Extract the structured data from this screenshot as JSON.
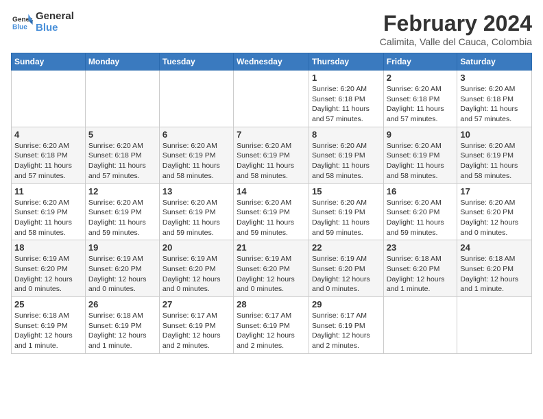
{
  "logo": {
    "line1": "General",
    "line2": "Blue"
  },
  "title": {
    "month_year": "February 2024",
    "location": "Calimita, Valle del Cauca, Colombia"
  },
  "days_of_week": [
    "Sunday",
    "Monday",
    "Tuesday",
    "Wednesday",
    "Thursday",
    "Friday",
    "Saturday"
  ],
  "weeks": [
    [
      {
        "day": "",
        "info": ""
      },
      {
        "day": "",
        "info": ""
      },
      {
        "day": "",
        "info": ""
      },
      {
        "day": "",
        "info": ""
      },
      {
        "day": "1",
        "info": "Sunrise: 6:20 AM\nSunset: 6:18 PM\nDaylight: 11 hours\nand 57 minutes."
      },
      {
        "day": "2",
        "info": "Sunrise: 6:20 AM\nSunset: 6:18 PM\nDaylight: 11 hours\nand 57 minutes."
      },
      {
        "day": "3",
        "info": "Sunrise: 6:20 AM\nSunset: 6:18 PM\nDaylight: 11 hours\nand 57 minutes."
      }
    ],
    [
      {
        "day": "4",
        "info": "Sunrise: 6:20 AM\nSunset: 6:18 PM\nDaylight: 11 hours\nand 57 minutes."
      },
      {
        "day": "5",
        "info": "Sunrise: 6:20 AM\nSunset: 6:18 PM\nDaylight: 11 hours\nand 57 minutes."
      },
      {
        "day": "6",
        "info": "Sunrise: 6:20 AM\nSunset: 6:19 PM\nDaylight: 11 hours\nand 58 minutes."
      },
      {
        "day": "7",
        "info": "Sunrise: 6:20 AM\nSunset: 6:19 PM\nDaylight: 11 hours\nand 58 minutes."
      },
      {
        "day": "8",
        "info": "Sunrise: 6:20 AM\nSunset: 6:19 PM\nDaylight: 11 hours\nand 58 minutes."
      },
      {
        "day": "9",
        "info": "Sunrise: 6:20 AM\nSunset: 6:19 PM\nDaylight: 11 hours\nand 58 minutes."
      },
      {
        "day": "10",
        "info": "Sunrise: 6:20 AM\nSunset: 6:19 PM\nDaylight: 11 hours\nand 58 minutes."
      }
    ],
    [
      {
        "day": "11",
        "info": "Sunrise: 6:20 AM\nSunset: 6:19 PM\nDaylight: 11 hours\nand 58 minutes."
      },
      {
        "day": "12",
        "info": "Sunrise: 6:20 AM\nSunset: 6:19 PM\nDaylight: 11 hours\nand 59 minutes."
      },
      {
        "day": "13",
        "info": "Sunrise: 6:20 AM\nSunset: 6:19 PM\nDaylight: 11 hours\nand 59 minutes."
      },
      {
        "day": "14",
        "info": "Sunrise: 6:20 AM\nSunset: 6:19 PM\nDaylight: 11 hours\nand 59 minutes."
      },
      {
        "day": "15",
        "info": "Sunrise: 6:20 AM\nSunset: 6:19 PM\nDaylight: 11 hours\nand 59 minutes."
      },
      {
        "day": "16",
        "info": "Sunrise: 6:20 AM\nSunset: 6:20 PM\nDaylight: 11 hours\nand 59 minutes."
      },
      {
        "day": "17",
        "info": "Sunrise: 6:20 AM\nSunset: 6:20 PM\nDaylight: 12 hours\nand 0 minutes."
      }
    ],
    [
      {
        "day": "18",
        "info": "Sunrise: 6:19 AM\nSunset: 6:20 PM\nDaylight: 12 hours\nand 0 minutes."
      },
      {
        "day": "19",
        "info": "Sunrise: 6:19 AM\nSunset: 6:20 PM\nDaylight: 12 hours\nand 0 minutes."
      },
      {
        "day": "20",
        "info": "Sunrise: 6:19 AM\nSunset: 6:20 PM\nDaylight: 12 hours\nand 0 minutes."
      },
      {
        "day": "21",
        "info": "Sunrise: 6:19 AM\nSunset: 6:20 PM\nDaylight: 12 hours\nand 0 minutes."
      },
      {
        "day": "22",
        "info": "Sunrise: 6:19 AM\nSunset: 6:20 PM\nDaylight: 12 hours\nand 0 minutes."
      },
      {
        "day": "23",
        "info": "Sunrise: 6:18 AM\nSunset: 6:20 PM\nDaylight: 12 hours\nand 1 minute."
      },
      {
        "day": "24",
        "info": "Sunrise: 6:18 AM\nSunset: 6:20 PM\nDaylight: 12 hours\nand 1 minute."
      }
    ],
    [
      {
        "day": "25",
        "info": "Sunrise: 6:18 AM\nSunset: 6:19 PM\nDaylight: 12 hours\nand 1 minute."
      },
      {
        "day": "26",
        "info": "Sunrise: 6:18 AM\nSunset: 6:19 PM\nDaylight: 12 hours\nand 1 minute."
      },
      {
        "day": "27",
        "info": "Sunrise: 6:17 AM\nSunset: 6:19 PM\nDaylight: 12 hours\nand 2 minutes."
      },
      {
        "day": "28",
        "info": "Sunrise: 6:17 AM\nSunset: 6:19 PM\nDaylight: 12 hours\nand 2 minutes."
      },
      {
        "day": "29",
        "info": "Sunrise: 6:17 AM\nSunset: 6:19 PM\nDaylight: 12 hours\nand 2 minutes."
      },
      {
        "day": "",
        "info": ""
      },
      {
        "day": "",
        "info": ""
      }
    ]
  ]
}
